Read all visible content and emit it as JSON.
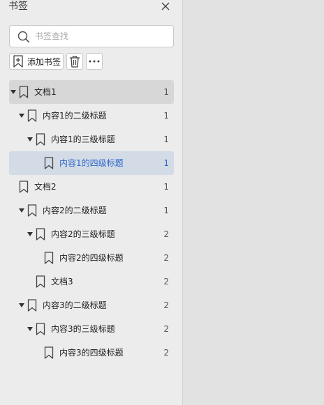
{
  "panel": {
    "title": "书签",
    "search_placeholder": "书签查找",
    "add_label": "添加书签"
  },
  "bookmarks": [
    {
      "label": "文档1",
      "count": "1",
      "level": 0,
      "expanded": true,
      "state": "selected"
    },
    {
      "label": "内容1的二级标题",
      "count": "1",
      "level": 1,
      "expanded": true,
      "state": ""
    },
    {
      "label": "内容1的三级标题",
      "count": "1",
      "level": 2,
      "expanded": true,
      "state": ""
    },
    {
      "label": "内容1的四级标题",
      "count": "1",
      "level": 3,
      "expanded": false,
      "state": "active"
    },
    {
      "label": "文档2",
      "count": "1",
      "level": 0,
      "expanded": false,
      "state": ""
    },
    {
      "label": "内容2的二级标题",
      "count": "1",
      "level": 1,
      "expanded": true,
      "state": ""
    },
    {
      "label": "内容2的三级标题",
      "count": "2",
      "level": 2,
      "expanded": true,
      "state": ""
    },
    {
      "label": "内容2的四级标题",
      "count": "2",
      "level": 3,
      "expanded": false,
      "state": ""
    },
    {
      "label": "文档3",
      "count": "2",
      "level": 2,
      "expanded": false,
      "state": ""
    },
    {
      "label": "内容3的二级标题",
      "count": "2",
      "level": 1,
      "expanded": true,
      "state": ""
    },
    {
      "label": "内容3的三级标题",
      "count": "2",
      "level": 2,
      "expanded": true,
      "state": ""
    },
    {
      "label": "内容3的四级标题",
      "count": "2",
      "level": 3,
      "expanded": false,
      "state": ""
    }
  ],
  "colors": {
    "accent": "#2f67c9",
    "active_row_bg": "#d2dbe6",
    "selected_row_bg": "#d7d7d7",
    "panel_bg": "#ececec",
    "workspace_bg": "#e2e2e2"
  }
}
